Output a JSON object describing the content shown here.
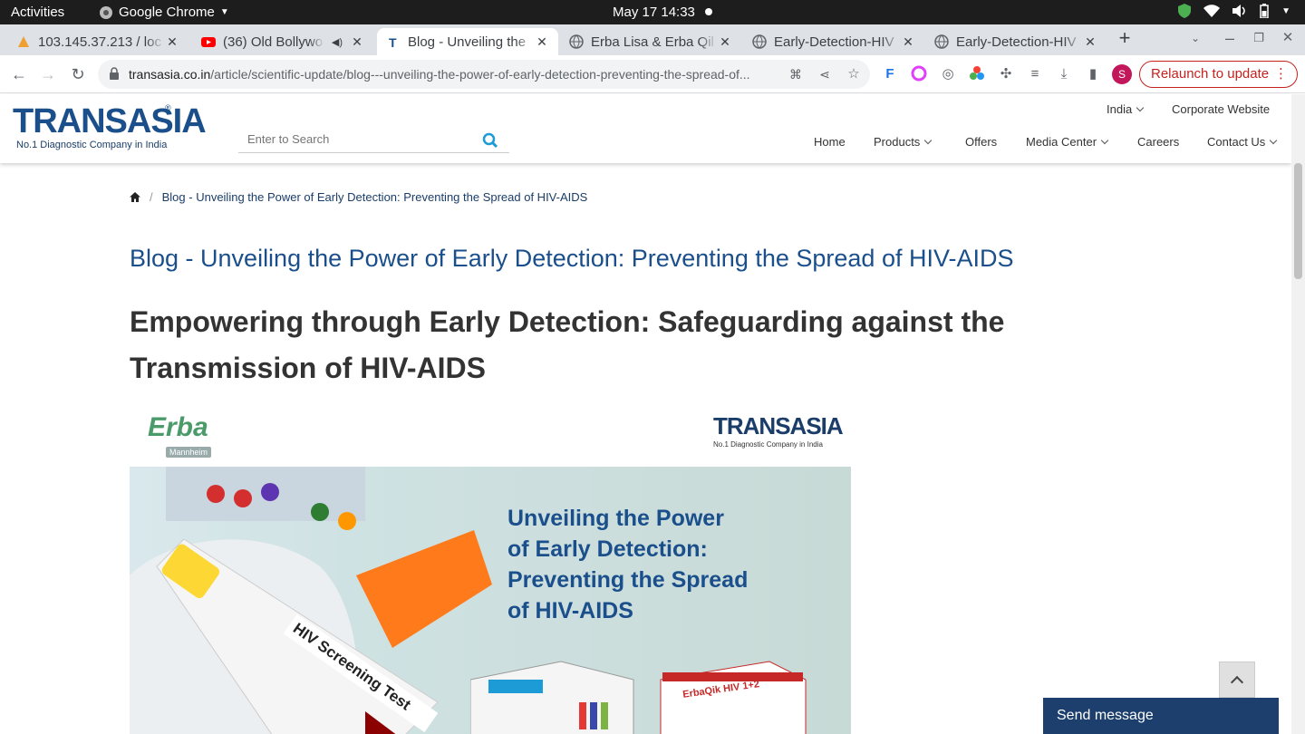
{
  "os_bar": {
    "activities": "Activities",
    "app_name": "Google Chrome",
    "datetime": "May 17  14:33"
  },
  "tabs": [
    {
      "title": "103.145.37.213 / loc"
    },
    {
      "title": "(36) Old Bollywo"
    },
    {
      "title": "Blog - Unveiling the"
    },
    {
      "title": "Erba Lisa & Erba Qil"
    },
    {
      "title": "Early-Detection-HIV"
    },
    {
      "title": "Early-Detection-HIV"
    }
  ],
  "omnibox": {
    "domain": "transasia.co.in",
    "path": "/article/scientific-update/blog---unveiling-the-power-of-early-detection-preventing-the-spread-of..."
  },
  "profile_initial": "S",
  "relaunch_label": "Relaunch to update",
  "site": {
    "logo_text": "TRANSASIA",
    "logo_tagline": "No.1 Diagnostic Company in India",
    "search_placeholder": "Enter to Search",
    "region": "India",
    "corporate": "Corporate Website",
    "nav": [
      "Home",
      "Products",
      "Offers",
      "Media Center",
      "Careers",
      "Contact Us"
    ]
  },
  "breadcrumb": {
    "current": "Blog - Unveiling the Power of Early Detection: Preventing the Spread of HIV-AIDS"
  },
  "article": {
    "title": "Blog - Unveiling the Power of Early Detection: Preventing the Spread of HIV-AIDS",
    "subtitle": "Empowering through Early Detection: Safeguarding against the Transmission of HIV-AIDS"
  },
  "banner": {
    "erba": "Erba",
    "erba_sub": "Mannheim",
    "brand": "TRANSASIA",
    "brand_tag": "No.1 Diagnostic Company in India",
    "headline_lines": [
      "Unveiling the Power",
      "of Early Detection:",
      "Preventing the Spread",
      "of HIV-AIDS"
    ],
    "tube_label": "HIV Screening Test",
    "kit_label": "ErbaQik HIV 1+2"
  },
  "send_message": "Send message",
  "colors": {
    "brand": "#1a4f8b",
    "accent": "#1c9bd6"
  }
}
